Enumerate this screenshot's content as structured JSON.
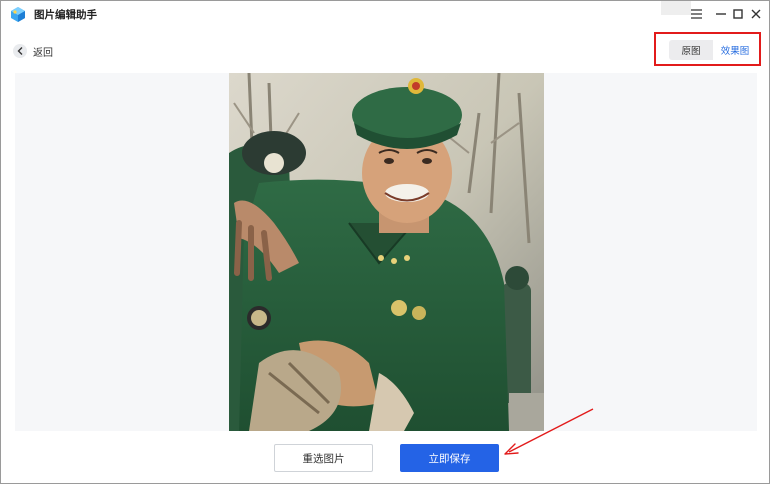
{
  "app": {
    "title": "图片编辑助手",
    "logo_icon": "app-logo-icon"
  },
  "window_controls": {
    "menu_icon": "menu-icon",
    "minimize_icon": "minimize-icon",
    "maximize_icon": "maximize-icon",
    "close_icon": "close-icon"
  },
  "header": {
    "back_label": "返回",
    "back_icon": "chevron-left-icon"
  },
  "view_toggle": {
    "original_label": "原图",
    "effect_label": "效果图",
    "selected": "效果图",
    "highlight_color": "#e21b1b"
  },
  "preview": {
    "image_desc": "colorized portrait photo"
  },
  "actions": {
    "reselect_label": "重选图片",
    "save_label": "立即保存",
    "primary_color": "#2463e6"
  },
  "annotation": {
    "arrow_color": "#e21b1b"
  }
}
